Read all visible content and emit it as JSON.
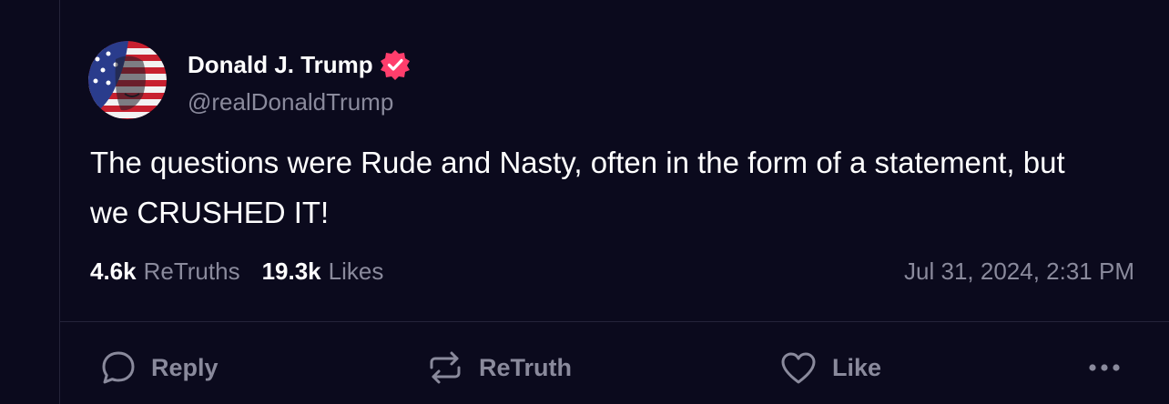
{
  "author": {
    "display_name": "Donald J. Trump",
    "handle": "@realDonaldTrump",
    "verified": true,
    "verified_color": "#ff3e6c"
  },
  "post": {
    "text": "The questions were Rude and Nasty, often in the form of a statement, but we CRUSHED IT!",
    "retruths_count": "4.6k",
    "retruths_label": "ReTruths",
    "likes_count": "19.3k",
    "likes_label": "Likes",
    "timestamp": "Jul 31, 2024, 2:31 PM"
  },
  "actions": {
    "reply_label": "Reply",
    "retruth_label": "ReTruth",
    "like_label": "Like",
    "more_icon": "ellipsis-icon"
  },
  "colors": {
    "background": "#0b0a1d",
    "text": "#ffffff",
    "muted": "#8a8a9c",
    "divider": "#25243a"
  }
}
